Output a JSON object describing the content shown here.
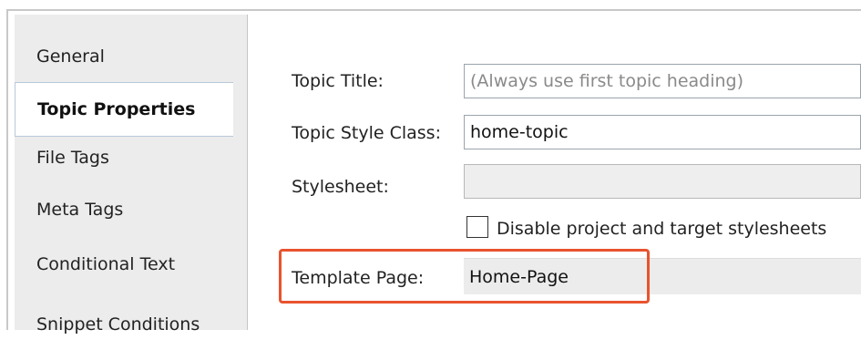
{
  "tabs": [
    {
      "label": "General",
      "active": false
    },
    {
      "label": "Topic Properties",
      "active": true
    },
    {
      "label": "File Tags",
      "active": false
    },
    {
      "label": "Meta Tags",
      "active": false
    },
    {
      "label": "Conditional Text",
      "active": false
    },
    {
      "label": "Snippet Conditions",
      "active": false
    }
  ],
  "form": {
    "topic_title": {
      "label": "Topic Title:",
      "placeholder": "(Always use first topic heading)"
    },
    "topic_style_class": {
      "label": "Topic Style Class:",
      "value": "home-topic"
    },
    "stylesheet": {
      "label": "Stylesheet:",
      "value": ""
    },
    "disable_stylesheets": {
      "label": "Disable project and target stylesheets",
      "checked": false
    },
    "template_page": {
      "label": "Template Page:",
      "value": "Home-Page"
    }
  },
  "colors": {
    "highlight": "#e8532f",
    "tab_background": "#ececec"
  }
}
